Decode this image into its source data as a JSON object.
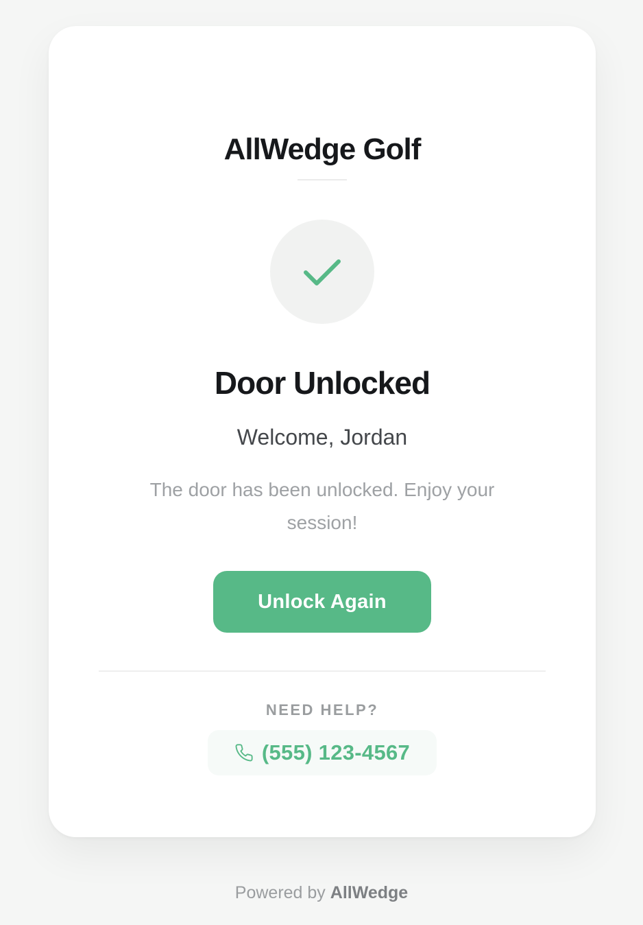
{
  "card": {
    "brand": "AllWedge Golf",
    "status_icon": "check-icon",
    "title": "Door Unlocked",
    "welcome": "Welcome, Jordan",
    "message": "The door has been unlocked. Enjoy your session!",
    "unlock_button_label": "Unlock Again",
    "help": {
      "label": "NEED HELP?",
      "phone_icon": "phone-icon",
      "phone_number": "(555) 123-4567"
    }
  },
  "footer": {
    "prefix": "Powered by",
    "brand": "AllWedge"
  },
  "colors": {
    "accent": "#57b987",
    "background": "#f5f6f5",
    "card": "#ffffff",
    "heading": "#16181b",
    "muted": "#9ea1a4"
  }
}
